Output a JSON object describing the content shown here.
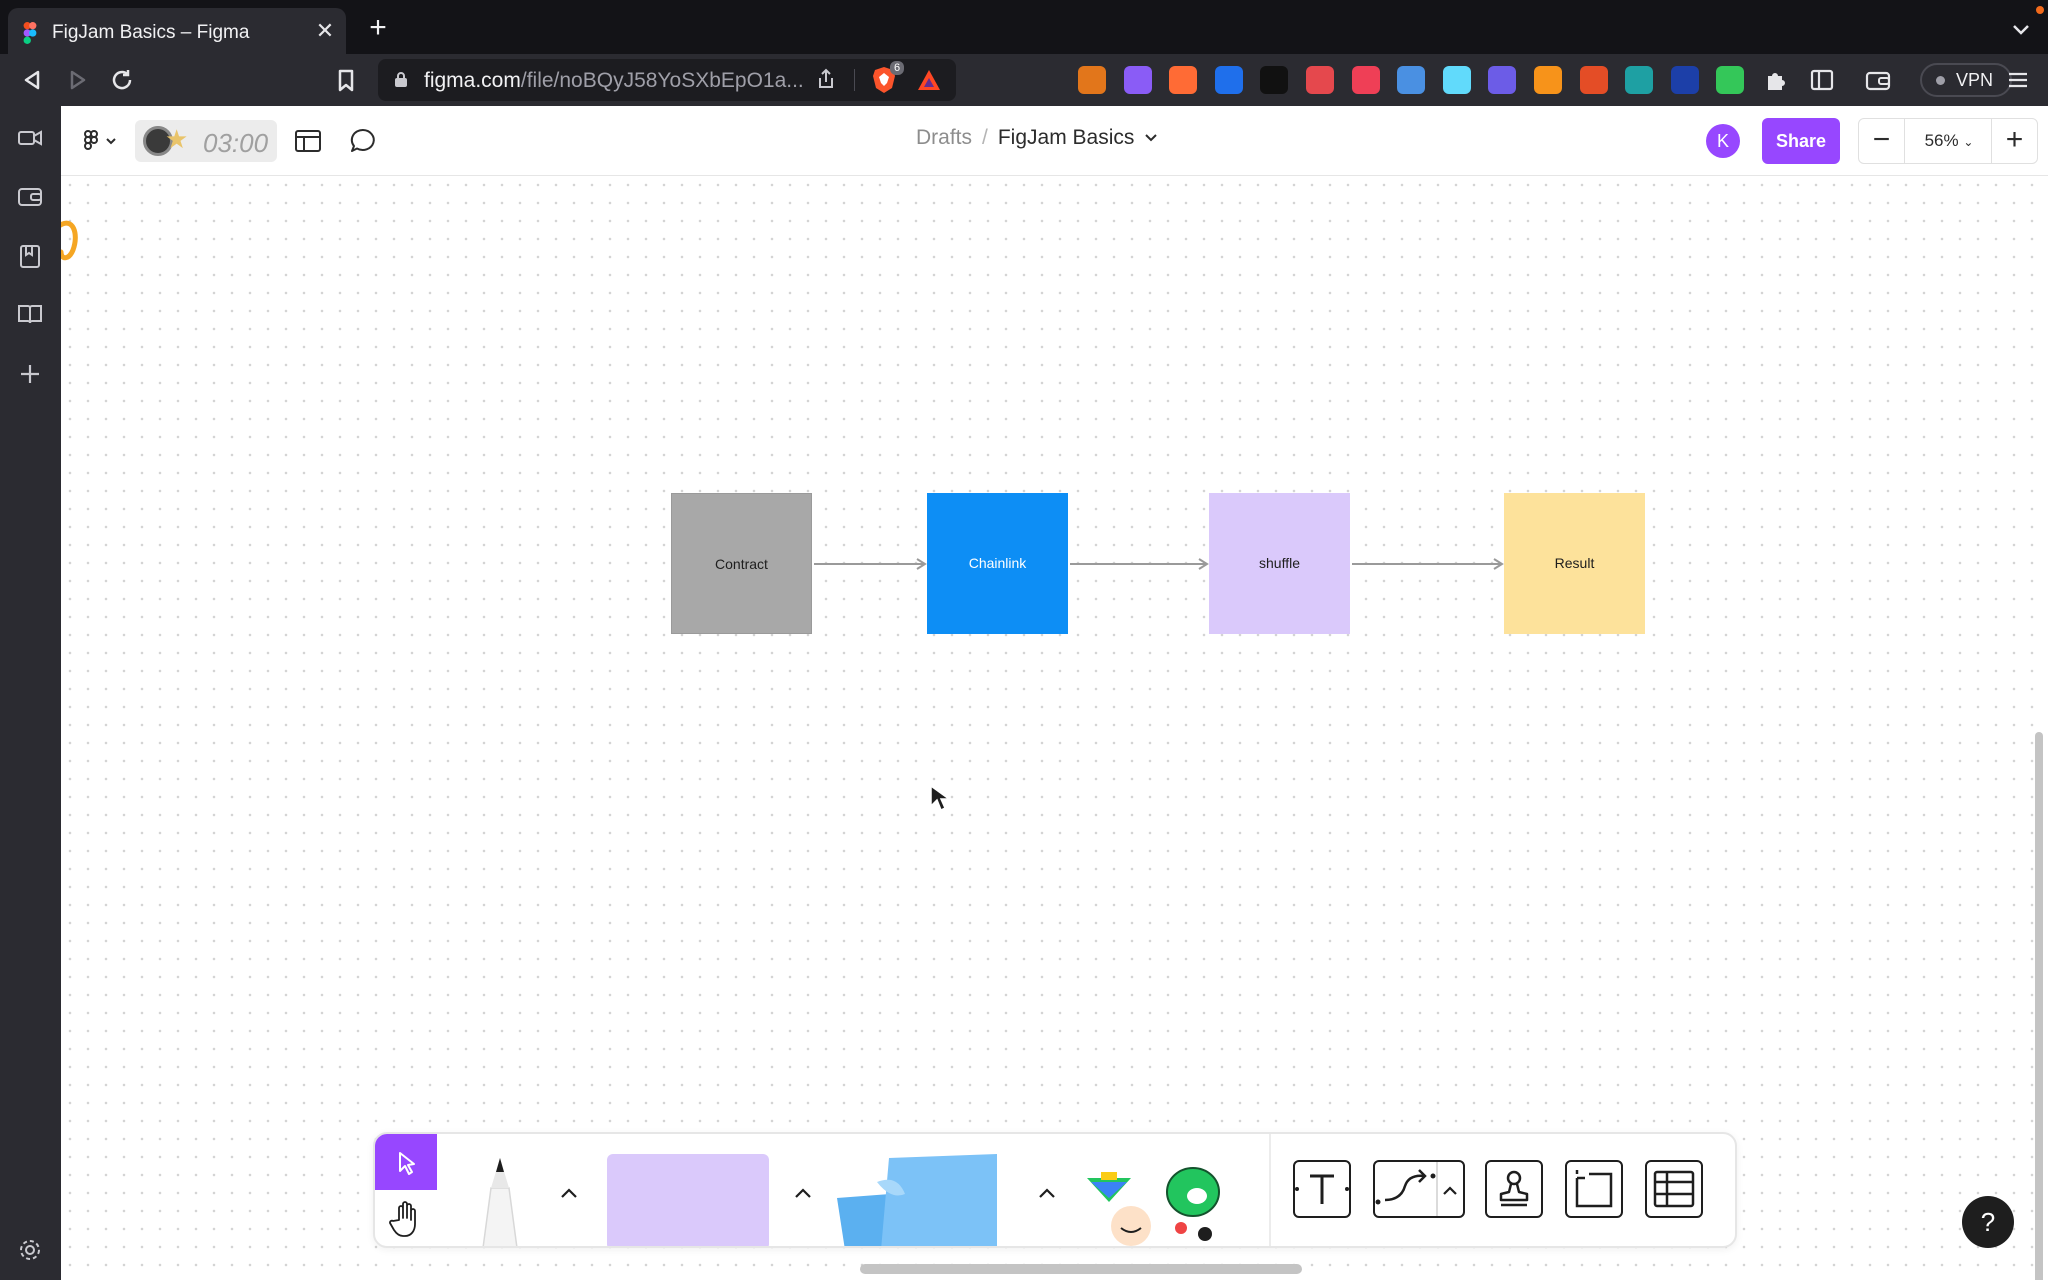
{
  "browser": {
    "tab_title": "FigJam Basics – Figma",
    "tab_close": "✕",
    "new_tab": "+",
    "url_host": "figma.com",
    "url_path": "/file/noBQyJ58YoSXbEpO1a...",
    "brave_badge": "6",
    "vpn_label": "VPN",
    "extensions": [
      {
        "name": "metamask-extension-icon",
        "color": "#e2761b"
      },
      {
        "name": "extension-purple-icon",
        "color": "#8a5cf6"
      },
      {
        "name": "extension-orange-icon",
        "color": "#ff6b35"
      },
      {
        "name": "extension-k-icon",
        "color": "#1f6feb"
      },
      {
        "name": "extension-dark-icon",
        "color": "#111111"
      },
      {
        "name": "extension-red-icon",
        "color": "#e5484d"
      },
      {
        "name": "extension-pocket-icon",
        "color": "#ef3f56"
      },
      {
        "name": "extension-drop-icon",
        "color": "#4a90e2"
      },
      {
        "name": "react-devtools-icon",
        "color": "#61dafb"
      },
      {
        "name": "extension-chat-icon",
        "color": "#6c5ce7"
      },
      {
        "name": "extension-coin-icon",
        "color": "#f7931a"
      },
      {
        "name": "extension-colorful-icon",
        "color": "#e44d26"
      },
      {
        "name": "extension-v-icon",
        "color": "#1ea0a3"
      },
      {
        "name": "extension-blue-icon",
        "color": "#1c3fa8"
      },
      {
        "name": "extension-green-icon",
        "color": "#34c759"
      }
    ]
  },
  "app": {
    "timer": "03:00",
    "breadcrumb_root": "Drafts",
    "breadcrumb_sep": "/",
    "file_name": "FigJam Basics",
    "avatar_initial": "K",
    "share_label": "Share",
    "zoom_minus": "−",
    "zoom_value": "56%",
    "zoom_plus": "+",
    "help_label": "?",
    "accent": "#9747ff"
  },
  "diagram": {
    "nodes": [
      {
        "label": "Contract",
        "color": "#a8a8a8"
      },
      {
        "label": "Chainlink",
        "color": "#0d8ef5"
      },
      {
        "label": "shuffle",
        "color": "#dac9fb"
      },
      {
        "label": "Result",
        "color": "#fde29b"
      }
    ],
    "edges": [
      [
        "Contract",
        "Chainlink"
      ],
      [
        "Chainlink",
        "shuffle"
      ],
      [
        "shuffle",
        "Result"
      ]
    ]
  },
  "bottom_toolbar": {
    "tools": [
      "select-tool",
      "hand-tool",
      "marker-tool",
      "shape-tool",
      "sticky-note-tool",
      "stickers-tool",
      "text-tool",
      "connector-tool",
      "stamp-tool",
      "section-tool",
      "table-tool"
    ]
  }
}
